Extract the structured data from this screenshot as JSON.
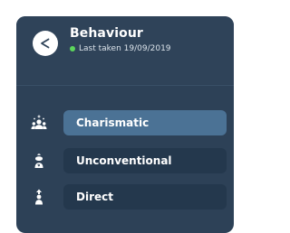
{
  "header": {
    "title": "Behaviour",
    "subtitle": "Last taken 19/09/2019",
    "back_icon": "back-arrow-icon",
    "status_color": "#5cd65c"
  },
  "traits": [
    {
      "label": "Charismatic",
      "icon": "people-spark-icon",
      "selected": true
    },
    {
      "label": "Unconventional",
      "icon": "person-swirl-icon",
      "selected": false
    },
    {
      "label": "Direct",
      "icon": "person-arrow-icon",
      "selected": false
    }
  ],
  "colors": {
    "card_bg": "#2d4157",
    "pill_bg": "#24384d",
    "pill_selected_bg": "#4b7295",
    "text": "#ffffff"
  }
}
